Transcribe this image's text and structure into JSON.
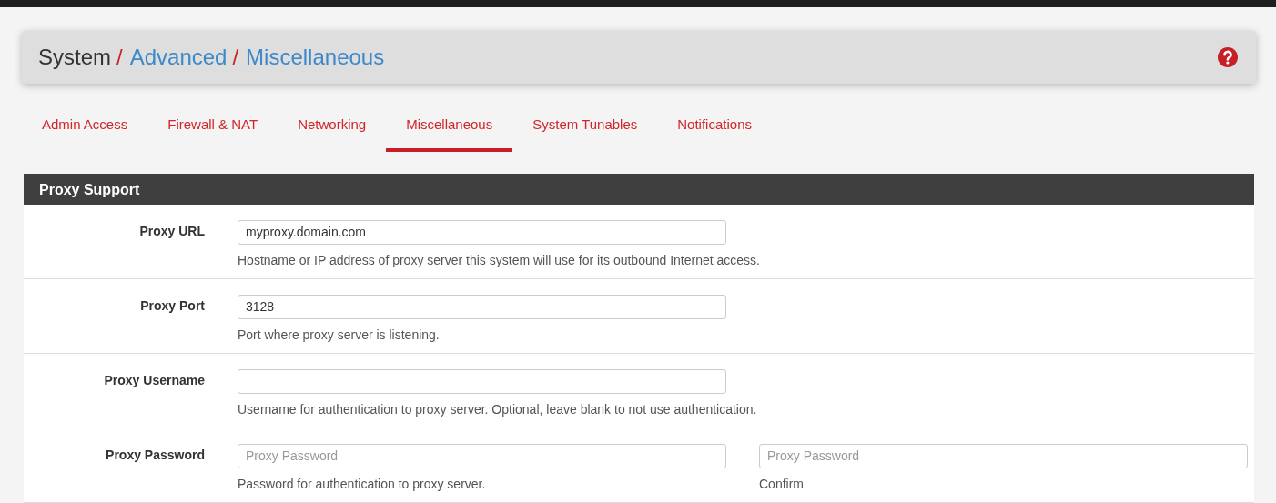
{
  "breadcrumb": [
    {
      "label": "System",
      "link": false
    },
    {
      "separator": "/",
      "label": "Advanced",
      "link": true
    },
    {
      "separator": "/",
      "label": "Miscellaneous",
      "link": true
    }
  ],
  "tabs": [
    {
      "label": "Admin Access",
      "selected": false
    },
    {
      "label": "Firewall & NAT",
      "selected": false
    },
    {
      "label": "Networking",
      "selected": false
    },
    {
      "label": "Miscellaneous",
      "selected": true
    },
    {
      "label": "System Tunables",
      "selected": false
    },
    {
      "label": "Notifications",
      "selected": false
    }
  ],
  "panel": {
    "title": "Proxy Support",
    "rows": [
      {
        "label": "Proxy URL",
        "fields": [
          {
            "value": "myproxy.domain.com",
            "help": "Hostname or IP address of proxy server this system will use for its outbound Internet access."
          }
        ]
      },
      {
        "label": "Proxy Port",
        "fields": [
          {
            "value": "3128",
            "help": "Port where proxy server is listening."
          }
        ]
      },
      {
        "label": "Proxy Username",
        "fields": [
          {
            "help": "Username for authentication to proxy server. Optional, leave blank to not use authentication."
          }
        ]
      },
      {
        "label": "Proxy Password",
        "fields": [
          {
            "placeholder": "Proxy Password",
            "help": "Password for authentication to proxy server."
          },
          {
            "placeholder": "Proxy Password",
            "help": "Confirm"
          }
        ]
      }
    ]
  }
}
